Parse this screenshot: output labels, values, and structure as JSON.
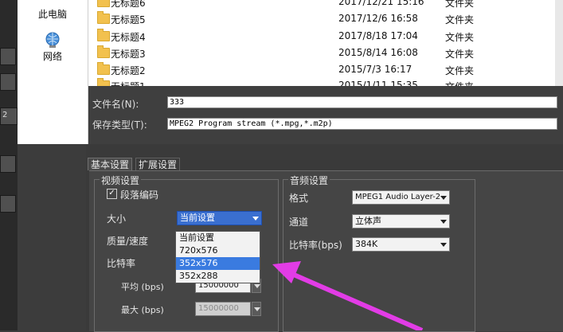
{
  "nav": {
    "items": [
      {
        "label": "此电脑",
        "icon": "computer-icon"
      },
      {
        "label": "网络",
        "icon": "network-globe-icon"
      }
    ]
  },
  "left_strip": {
    "mark": "2"
  },
  "files": [
    {
      "name": "无标题6",
      "date": "2017/12/21 15:16",
      "type": "文件夹"
    },
    {
      "name": "无标题5",
      "date": "2017/12/6 16:58",
      "type": "文件夹"
    },
    {
      "name": "无标题4",
      "date": "2017/8/18 17:04",
      "type": "文件夹"
    },
    {
      "name": "无标题3",
      "date": "2015/8/14 16:08",
      "type": "文件夹"
    },
    {
      "name": "无标题2",
      "date": "2015/7/3 16:17",
      "type": "文件夹"
    },
    {
      "name": "无标题1",
      "date": "2015/1/11 15:35",
      "type": "文件夹"
    }
  ],
  "dialog": {
    "filename_label": "文件名(N):",
    "filename_value": "333",
    "savetype_label": "保存类型(T):",
    "savetype_value": "MPEG2 Program stream (*.mpg,*.m2p)"
  },
  "tabs": {
    "basic": "基本设置",
    "extended": "扩展设置"
  },
  "video": {
    "title": "视频设置",
    "segment_encoding_label": "段落编码",
    "segment_encoding_checked": true,
    "size_label": "大小",
    "size_value": "当前设置",
    "size_options": [
      "当前设置",
      "720x576",
      "352x576",
      "352x288"
    ],
    "size_highlighted": "352x576",
    "quality_label": "质量/速度",
    "bitrate_label": "比特率",
    "avg_label": "平均 (bps)",
    "avg_value": "15000000",
    "max_label": "最大 (bps)",
    "max_value": "15000000"
  },
  "audio": {
    "title": "音频设置",
    "format_label": "格式",
    "format_value": "MPEG1 Audio Layer-2",
    "channel_label": "通道",
    "channel_value": "立体声",
    "bitrate_label": "比特率(bps)",
    "bitrate_value": "384K"
  },
  "colors": {
    "arrow": "#e23ce6",
    "highlight": "#3a7be0"
  }
}
